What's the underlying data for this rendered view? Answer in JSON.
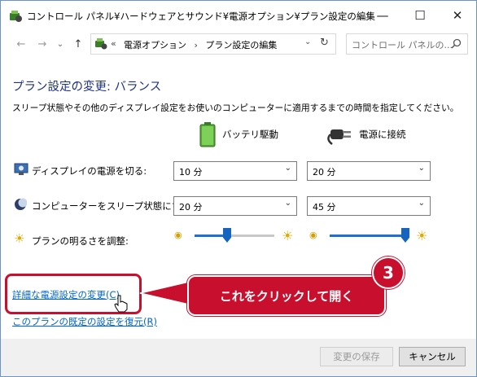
{
  "window": {
    "title": "コントロール パネル¥ハードウェアとサウンド¥電源オプション¥プラン設定の編集",
    "minimize": "—",
    "maximize": "☐",
    "close": "✕"
  },
  "address": {
    "back": "←",
    "forward": "→",
    "dropdown": "⌄",
    "up": "↑",
    "prefix": "«",
    "crumb1": "電源オプション",
    "sep": "›",
    "crumb2": "プラン設定の編集",
    "crumb_dropdown": "⌄",
    "refresh": "↻",
    "search_placeholder": "コントロール パネルの..."
  },
  "main": {
    "heading": "プラン設定の変更: バランス",
    "description": "スリープ状態やその他のディスプレイ設定をお使いのコンピューターに適用するまでの時間を指定してください。",
    "col_battery": "バッテリ駆動",
    "col_plugged": "電源に接続",
    "rows": [
      {
        "label": "ディスプレイの電源を切る:",
        "battery": "10 分",
        "plugged": "20 分"
      },
      {
        "label": "コンピューターをスリープ状態にする:",
        "battery": "20 分",
        "plugged": "45 分"
      }
    ],
    "brightness_label": "プランの明るさを調整:",
    "brightness_battery": 0.4,
    "brightness_plugged": 1.0,
    "link_advanced": "詳細な電源設定の変更(C)",
    "link_restore": "このプランの既定の設定を復元(R)"
  },
  "footer": {
    "save": "変更の保存",
    "cancel": "キャンセル"
  },
  "annotation": {
    "step": "3",
    "callout": "これをクリックして開く"
  },
  "colors": {
    "accent_red": "#c8102e",
    "heading_blue": "#1e3287",
    "link_blue": "#0066cc"
  }
}
